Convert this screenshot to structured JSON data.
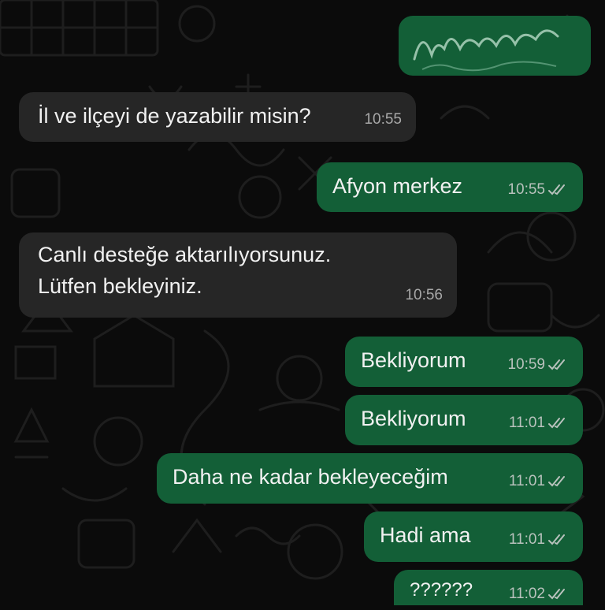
{
  "messages": [
    {
      "dir": "in",
      "text": "İl ve ilçeyi de yazabilir misin?",
      "time": "10:55"
    },
    {
      "dir": "out",
      "text": "Afyon merkez",
      "time": "10:55",
      "status": "read"
    },
    {
      "dir": "in",
      "text": "Canlı desteğe aktarılıyorsunuz. Lütfen bekleyiniz.",
      "time": "10:56"
    },
    {
      "dir": "out",
      "text": "Bekliyorum",
      "time": "10:59",
      "status": "read"
    },
    {
      "dir": "out",
      "text": "Bekliyorum",
      "time": "11:01",
      "status": "read"
    },
    {
      "dir": "out",
      "text": "Daha ne kadar bekleyeceğim",
      "time": "11:01",
      "status": "read"
    },
    {
      "dir": "out",
      "text": "Hadi ama",
      "time": "11:01",
      "status": "read"
    },
    {
      "dir": "out",
      "text": "??????",
      "time": "11:02",
      "status": "read"
    }
  ],
  "colors": {
    "background": "#0b0b0b",
    "incoming_bubble": "#262626",
    "outgoing_bubble": "#135f37",
    "text": "#f1f1f1"
  },
  "icons": {
    "read_receipt": "double-check-icon"
  }
}
